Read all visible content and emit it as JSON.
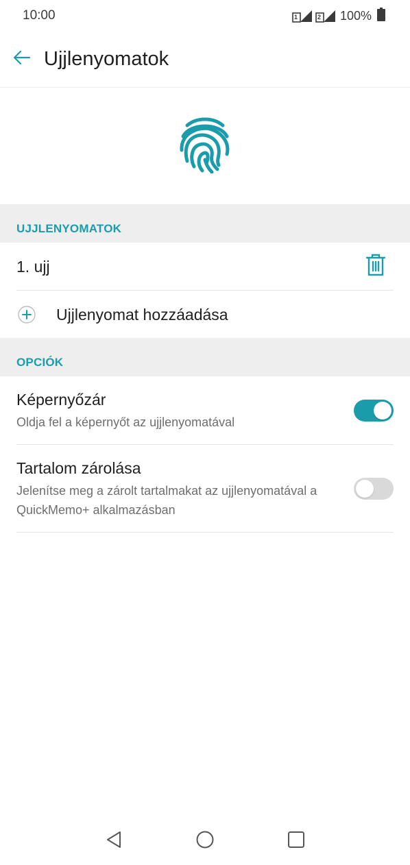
{
  "status_bar": {
    "time": "10:00",
    "battery": "100%",
    "sim1_label": "1",
    "sim2_label": "2"
  },
  "toolbar": {
    "title": "Ujjlenyomatok",
    "back_icon": "arrow-left-icon"
  },
  "hero": {
    "icon": "fingerprint-icon"
  },
  "sections": {
    "fingerprints_header": "UJJLENYOMATOK",
    "options_header": "OPCIÓK"
  },
  "fingerprints": {
    "items": [
      {
        "label": "1. ujj",
        "action_icon": "trash-icon"
      }
    ],
    "add_label": "Ujjlenyomat hozzáadása"
  },
  "options": {
    "screen_lock": {
      "title": "Képernyőzár",
      "subtitle": "Oldja fel a képernyőt az ujjlenyomatával",
      "enabled": true
    },
    "content_lock": {
      "title": "Tartalom zárolása",
      "subtitle": "Jelenítse meg a zárolt tartalmakat az ujjlenyomatával a QuickMemo+ alkalmazásban",
      "enabled": false
    }
  },
  "colors": {
    "accent": "#1a9cab",
    "section_bg": "#eeeeee",
    "toggle_off": "#d9d9d9"
  },
  "nav": {
    "back_icon": "nav-back-triangle-icon",
    "home_icon": "nav-home-circle-icon",
    "recents_icon": "nav-recents-square-icon"
  }
}
